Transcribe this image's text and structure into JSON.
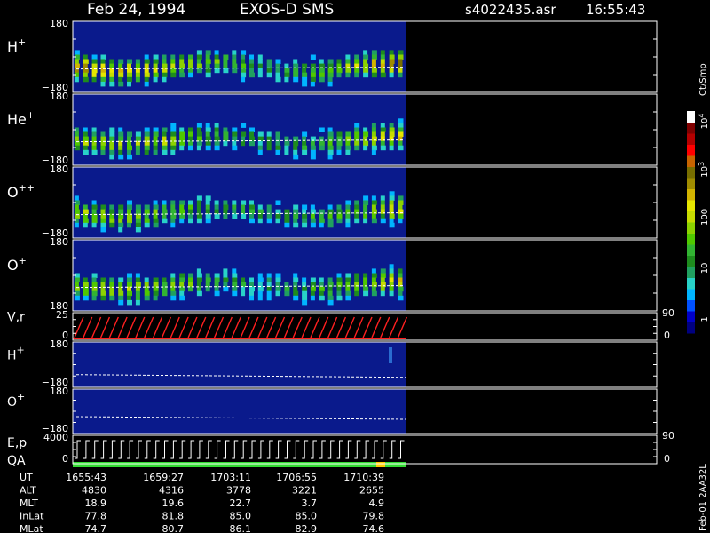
{
  "header": {
    "date": "Feb 24, 1994",
    "instrument": "EXOS-D SMS",
    "file": "s4022435.asr",
    "time": "16:55:43"
  },
  "colors": {
    "background": "#000000",
    "panel_fill": "#0a1a8c",
    "frame": "#ffffff",
    "guide_line": "#ffffff",
    "vr_trace": "#ff2020",
    "qa_bar": "#33dd33",
    "qa_flag": "#ffcc00"
  },
  "colorbar": {
    "unit_label": "Ct/Smp",
    "tick_labels": [
      "1",
      "10",
      "100",
      "10",
      "10"
    ],
    "tick_superscripts": [
      "",
      "",
      "",
      "3",
      "4"
    ],
    "tick_values": [
      1,
      10,
      100,
      1000,
      10000
    ],
    "range": [
      0.5,
      20000
    ],
    "scale": "log",
    "colors": [
      "#000080",
      "#0000c8",
      "#0050ff",
      "#00b4ff",
      "#28d2c8",
      "#20a060",
      "#1e8c1e",
      "#32b432",
      "#50c800",
      "#8cd200",
      "#c8dc00",
      "#e6e600",
      "#d2b400",
      "#a08c00",
      "#786e00",
      "#c86400",
      "#ff0000",
      "#b40000",
      "#800000",
      "#ffffff"
    ]
  },
  "panels": [
    {
      "label": "H",
      "sup": "+",
      "tick_labels": [
        "180",
        "−180"
      ],
      "right_labels": []
    },
    {
      "label": "He",
      "sup": "+",
      "tick_labels": [
        "180",
        "−180"
      ],
      "right_labels": []
    },
    {
      "label": "O",
      "sup": "++",
      "tick_labels": [
        "180",
        "−180"
      ],
      "right_labels": []
    },
    {
      "label": "O",
      "sup": "+",
      "tick_labels": [
        "180",
        "−180"
      ],
      "right_labels": []
    },
    {
      "label": "V,r",
      "sup": "",
      "tick_labels": [
        "25",
        "0"
      ],
      "right_labels": [
        "90",
        "0"
      ]
    },
    {
      "label": "H",
      "sup": "+",
      "tick_labels": [
        "180",
        "−180"
      ],
      "right_labels": []
    },
    {
      "label": "O",
      "sup": "+",
      "tick_labels": [
        "180",
        "−180"
      ],
      "right_labels": []
    },
    {
      "label": "E,p",
      "label2": "QA",
      "sup": "",
      "tick_labels": [
        "4000",
        "0"
      ],
      "right_labels": [
        "90",
        "0"
      ]
    }
  ],
  "orbit_table": {
    "row_labels": [
      "UT",
      "ALT",
      "MLT",
      "InLat",
      "MLat"
    ],
    "columns": [
      {
        "UT": "1655:43",
        "ALT": "4830",
        "MLT": "18.9",
        "InLat": "77.8",
        "MLat": "−74.7"
      },
      {
        "UT": "1659:27",
        "ALT": "4316",
        "MLT": "19.6",
        "InLat": "81.8",
        "MLat": "−80.7"
      },
      {
        "UT": "1703:11",
        "ALT": "3778",
        "MLT": "22.7",
        "InLat": "85.0",
        "MLat": "−86.1"
      },
      {
        "UT": "1706:55",
        "ALT": "3221",
        "MLT": "3.7",
        "InLat": "85.0",
        "MLat": "−82.9"
      },
      {
        "UT": "1710:39",
        "ALT": "2655",
        "MLT": "4.9",
        "InLat": "79.8",
        "MLat": "−74.6"
      }
    ]
  },
  "footer_note": "Feb-01 2AA32L",
  "chart_data": {
    "type": "heatmap",
    "title": "Feb 24, 1994   EXOS-D SMS",
    "x_ticks": [
      "1655:43",
      "1659:27",
      "1703:11",
      "1706:55",
      "1710:39"
    ],
    "x_range_minutes": [
      0,
      18.7
    ],
    "spin_period_minutes": 0.49,
    "colorbar_unit": "Ct/Smp",
    "series": [
      {
        "name": "H+",
        "ylim": [
          -180,
          180
        ],
        "intensity": [
          0.85,
          0.8,
          0.75,
          0.7,
          0.7,
          0.65,
          0.6,
          0.6,
          0.55,
          0.5,
          0.45,
          0.4,
          0.4,
          0.45,
          0.5,
          0.55,
          0.6,
          0.7,
          0.8,
          0.9
        ]
      },
      {
        "name": "He+",
        "ylim": [
          -180,
          180
        ],
        "intensity": [
          0.6,
          0.65,
          0.65,
          0.65,
          0.6,
          0.6,
          0.55,
          0.5,
          0.45,
          0.4,
          0.4,
          0.4,
          0.4,
          0.45,
          0.45,
          0.5,
          0.55,
          0.6,
          0.7,
          0.75
        ]
      },
      {
        "name": "O++",
        "ylim": [
          -180,
          180
        ],
        "intensity": [
          0.6,
          0.62,
          0.6,
          0.6,
          0.58,
          0.55,
          0.5,
          0.48,
          0.45,
          0.42,
          0.4,
          0.4,
          0.4,
          0.42,
          0.45,
          0.48,
          0.5,
          0.55,
          0.65,
          0.72
        ]
      },
      {
        "name": "O+",
        "ylim": [
          -180,
          180
        ],
        "intensity": [
          0.62,
          0.65,
          0.65,
          0.62,
          0.6,
          0.58,
          0.55,
          0.5,
          0.45,
          0.4,
          0.4,
          0.38,
          0.4,
          0.42,
          0.45,
          0.48,
          0.52,
          0.58,
          0.68,
          0.75
        ]
      },
      {
        "name": "V,r",
        "ylim": [
          0,
          25
        ],
        "right_ylim": [
          0,
          90
        ],
        "pattern": "sawtooth"
      },
      {
        "name": "H+ (lower)",
        "ylim": [
          -180,
          180
        ],
        "intensity": [
          0.05,
          0.05,
          0.05,
          0.05,
          0.05,
          0.05,
          0.05,
          0.05,
          0.05,
          0.05,
          0.05,
          0.05,
          0.05,
          0.05,
          0.05,
          0.05,
          0.05,
          0.08,
          0.2,
          0.1
        ]
      },
      {
        "name": "O+ (lower)",
        "ylim": [
          -180,
          180
        ],
        "intensity": [
          0,
          0,
          0,
          0,
          0,
          0,
          0,
          0,
          0,
          0,
          0,
          0,
          0,
          0,
          0,
          0,
          0,
          0,
          0,
          0
        ]
      },
      {
        "name": "E,p",
        "ylim": [
          0,
          4000
        ],
        "right_ylim": [
          0,
          90
        ],
        "pattern": "steps"
      }
    ]
  }
}
